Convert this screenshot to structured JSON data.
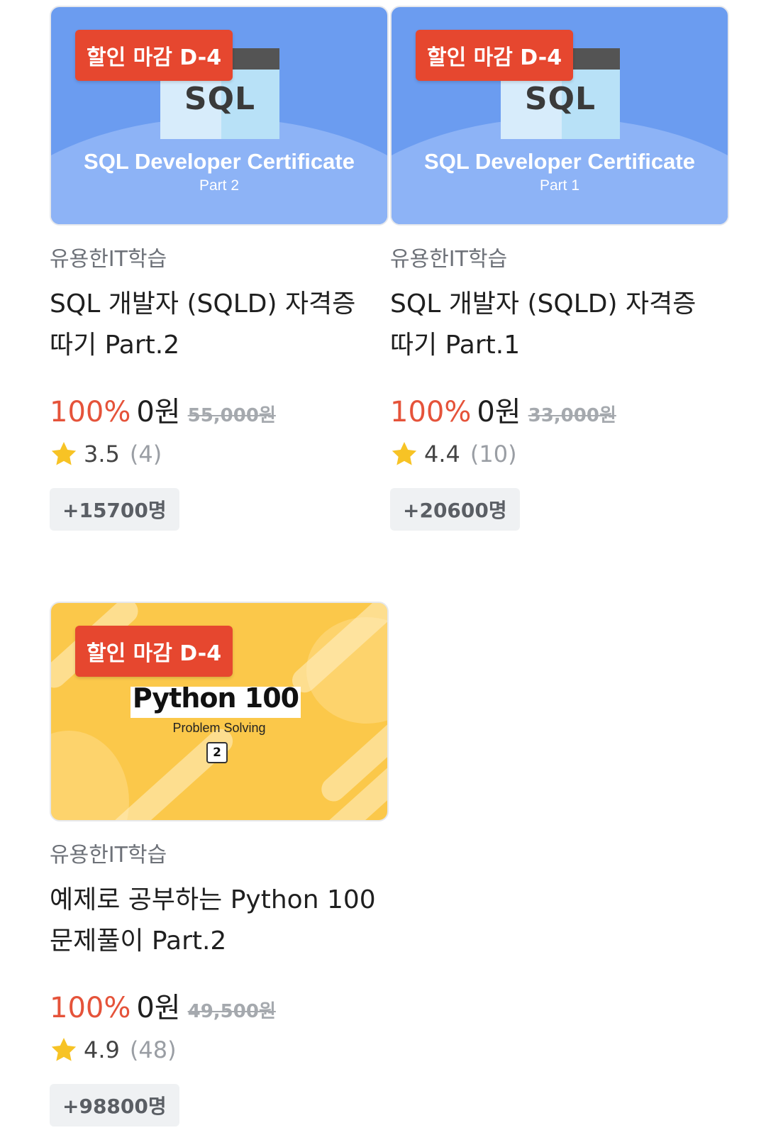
{
  "courses": [
    {
      "badge": "할인 마감 D-4",
      "thumb_logo": "SQL",
      "thumb_title": "SQL Developer Certificate",
      "thumb_part": "Part 2",
      "instructor": "유용한IT학습",
      "title_line1": "SQL 개발자 (SQLD) 자격증",
      "title_line2": "따기 Part.2",
      "discount": "100%",
      "sale_price": "0원",
      "original_price": "55,000원",
      "rating": "3.5",
      "review_count": "(4)",
      "students": "+15700명"
    },
    {
      "badge": "할인 마감 D-4",
      "thumb_logo": "SQL",
      "thumb_title": "SQL Developer Certificate",
      "thumb_part": "Part 1",
      "instructor": "유용한IT학습",
      "title_line1": "SQL 개발자 (SQLD) 자격증",
      "title_line2": "따기 Part.1",
      "discount": "100%",
      "sale_price": "0원",
      "original_price": "33,000원",
      "rating": "4.4",
      "review_count": "(10)",
      "students": "+20600명"
    },
    {
      "badge": "할인 마감 D-4",
      "thumb_title": "Python 100",
      "thumb_subtitle": "Problem Solving",
      "thumb_number": "2",
      "instructor": "유용한IT학습",
      "title_line1": "예제로 공부하는 Python 100",
      "title_line2": "문제풀이 Part.2",
      "discount": "100%",
      "sale_price": "0원",
      "original_price": "49,500원",
      "rating": "4.9",
      "review_count": "(48)",
      "students": "+98800명"
    }
  ],
  "icons": {
    "rating": "star-icon"
  },
  "colors": {
    "discount": "#e5533a",
    "badge": "#e6472f",
    "sql_thumb": "#6b9cf0",
    "python_thumb": "#fbc84a",
    "star": "#f7c325"
  }
}
